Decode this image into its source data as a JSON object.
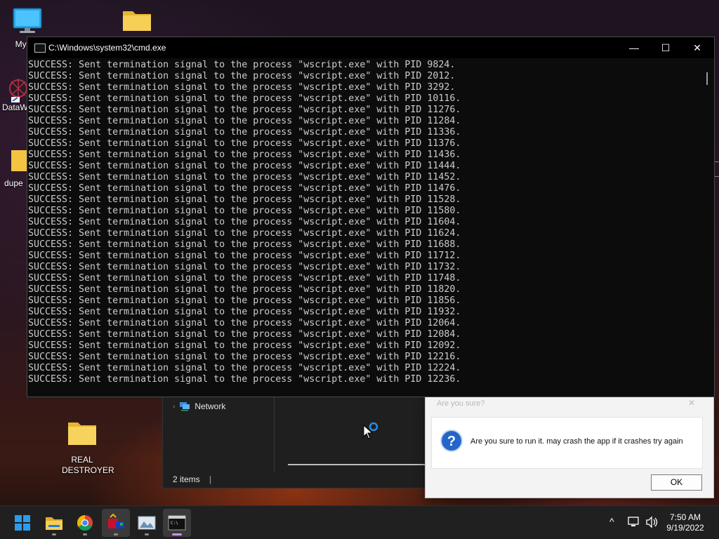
{
  "desktop": {
    "icons": [
      {
        "label": "My Co"
      },
      {
        "label": "DataW"
      },
      {
        "label": "dupe"
      },
      {
        "label": "REAL DESTROYER"
      }
    ]
  },
  "explorer": {
    "nav_item": "Network",
    "status": "2 items"
  },
  "dialog": {
    "title": "Are you sure?",
    "message": "Are you sure to run it. may crash the app if it crashes try again",
    "ok_label": "OK",
    "close_glyph": "✕"
  },
  "cmd": {
    "title": "C:\\Windows\\system32\\cmd.exe",
    "minimize": "—",
    "maximize": "☐",
    "close": "✕",
    "lines": [
      "SUCCESS: Sent termination signal to the process \"wscript.exe\" with PID 9824.",
      "SUCCESS: Sent termination signal to the process \"wscript.exe\" with PID 2012.",
      "SUCCESS: Sent termination signal to the process \"wscript.exe\" with PID 3292.",
      "SUCCESS: Sent termination signal to the process \"wscript.exe\" with PID 10116.",
      "SUCCESS: Sent termination signal to the process \"wscript.exe\" with PID 11276.",
      "SUCCESS: Sent termination signal to the process \"wscript.exe\" with PID 11284.",
      "SUCCESS: Sent termination signal to the process \"wscript.exe\" with PID 11336.",
      "SUCCESS: Sent termination signal to the process \"wscript.exe\" with PID 11376.",
      "SUCCESS: Sent termination signal to the process \"wscript.exe\" with PID 11436.",
      "SUCCESS: Sent termination signal to the process \"wscript.exe\" with PID 11444.",
      "SUCCESS: Sent termination signal to the process \"wscript.exe\" with PID 11452.",
      "SUCCESS: Sent termination signal to the process \"wscript.exe\" with PID 11476.",
      "SUCCESS: Sent termination signal to the process \"wscript.exe\" with PID 11528.",
      "SUCCESS: Sent termination signal to the process \"wscript.exe\" with PID 11580.",
      "SUCCESS: Sent termination signal to the process \"wscript.exe\" with PID 11604.",
      "SUCCESS: Sent termination signal to the process \"wscript.exe\" with PID 11624.",
      "SUCCESS: Sent termination signal to the process \"wscript.exe\" with PID 11688.",
      "SUCCESS: Sent termination signal to the process \"wscript.exe\" with PID 11712.",
      "SUCCESS: Sent termination signal to the process \"wscript.exe\" with PID 11732.",
      "SUCCESS: Sent termination signal to the process \"wscript.exe\" with PID 11748.",
      "SUCCESS: Sent termination signal to the process \"wscript.exe\" with PID 11820.",
      "SUCCESS: Sent termination signal to the process \"wscript.exe\" with PID 11856.",
      "SUCCESS: Sent termination signal to the process \"wscript.exe\" with PID 11932.",
      "SUCCESS: Sent termination signal to the process \"wscript.exe\" with PID 12064.",
      "SUCCESS: Sent termination signal to the process \"wscript.exe\" with PID 12084.",
      "SUCCESS: Sent termination signal to the process \"wscript.exe\" with PID 12092.",
      "SUCCESS: Sent termination signal to the process \"wscript.exe\" with PID 12216.",
      "SUCCESS: Sent termination signal to the process \"wscript.exe\" with PID 12224.",
      "SUCCESS: Sent termination signal to the process \"wscript.exe\" with PID 12236."
    ]
  },
  "taskbar": {
    "apps": [
      {
        "name": "start-icon"
      },
      {
        "name": "file-explorer-icon"
      },
      {
        "name": "chrome-icon"
      },
      {
        "name": "app-icon"
      },
      {
        "name": "photos-icon"
      },
      {
        "name": "terminal-icon"
      }
    ],
    "tray": {
      "chevron": "^",
      "time": "7:50 AM",
      "date": "9/19/2022"
    }
  },
  "colors": {
    "console_text": "#cccccc",
    "console_bg": "#0c0c0c",
    "taskbar_bg": "#202020",
    "accent": "#0078d4"
  }
}
